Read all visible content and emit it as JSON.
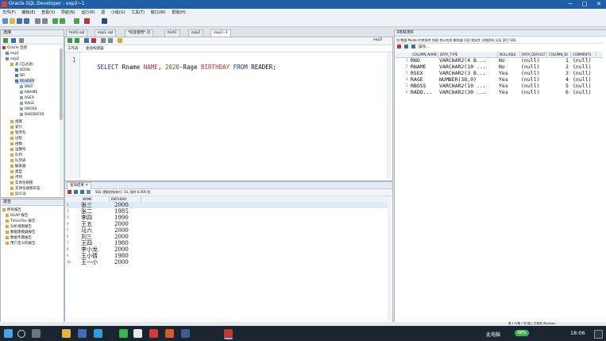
{
  "window": {
    "title": "Oracle SQL Developer : exp2~1",
    "minimize": "─",
    "maximize": "□",
    "close": "✕"
  },
  "menu": [
    "文件(F)",
    "编辑(E)",
    "查看(V)",
    "导航(N)",
    "运行(R)",
    "源",
    "小组(G)",
    "工具(T)",
    "窗口(W)",
    "帮助(H)"
  ],
  "connections": {
    "header": "连接",
    "rows": [
      "Oracle 连接",
      "exp1",
      "exp2",
      "表 (已过滤)",
      "BOOK",
      "BR",
      "READER",
      "RNO",
      "RNAME",
      "RSEX",
      "RAGE",
      "RBOSS",
      "RADDRESS",
      "视图",
      "索引",
      "程序包",
      "过程",
      "函数",
      "运算符",
      "队列",
      "队列表",
      "触发器",
      "类型",
      "序列",
      "实体化视图",
      "实体化视图日志",
      "同义词"
    ]
  },
  "reports": {
    "header": "报告",
    "rows": [
      "所有报告",
      "OLAP 报告",
      "TimesTen 报告",
      "分析视图报告",
      "数据建模器报告",
      "数据字典报告",
      "用户定义的报告"
    ]
  },
  "editor_tabs": [
    "test1.sql",
    "exp1.sql",
    "*欢迎使用*.页",
    "test1",
    "exp2",
    "exp2~1"
  ],
  "editor": {
    "subtabs": [
      "工作表",
      "查询构建器"
    ],
    "conn_label": "exp2",
    "line_no": "1",
    "sql": {
      "kw1": "SELECT",
      "body1": " Rname ",
      "alias1": "NAME",
      "sep": ", ",
      "num": "2020",
      "body2": "-Rage ",
      "alias2": "BIRTHDAY",
      "kw2": " FROM",
      "body3": " READER;"
    }
  },
  "results": {
    "tab": "查询结果",
    "status": "SQL  提取的所有行: 10,  用时 0.005 秒",
    "columns": [
      "NAME",
      "BIRTHDAY"
    ],
    "rows": [
      {
        "n": "1",
        "name": "张三",
        "birthday": "2000"
      },
      {
        "n": "2",
        "name": "张二",
        "birthday": "1985"
      },
      {
        "n": "3",
        "name": "李四",
        "birthday": "1990"
      },
      {
        "n": "4",
        "name": "王五",
        "birthday": "2000"
      },
      {
        "n": "5",
        "name": "马六",
        "birthday": "2000"
      },
      {
        "n": "6",
        "name": "刘三",
        "birthday": "2000"
      },
      {
        "n": "7",
        "name": "王四",
        "birthday": "1980"
      },
      {
        "n": "8",
        "name": "李小龙",
        "birthday": "2000"
      },
      {
        "n": "9",
        "name": "王小倩",
        "birthday": "1980"
      },
      {
        "n": "10",
        "name": "王一小",
        "birthday": "2000"
      }
    ]
  },
  "reader": {
    "header": "READER",
    "subtabs": "列 数据 Model 约束条件 授权 统计信息 触发器 闪回 相关性 详细资料 分区 索引 SQL",
    "action": "操作...",
    "columns": [
      "COLUMN_NAME",
      "DATA_TYPE",
      "NULLABLE",
      "DATA_DEFAULT",
      "COLUMN_ID",
      "COMMENTS"
    ],
    "rows": [
      {
        "n": "1",
        "name": "RNO",
        "type": "VARCHAR2(4 B...",
        "nullable": "No",
        "def": "(null)",
        "id": "1",
        "cm": "(null)"
      },
      {
        "n": "2",
        "name": "RNAME",
        "type": "VARCHAR2(10 ...",
        "nullable": "No",
        "def": "(null)",
        "id": "2",
        "cm": "(null)"
      },
      {
        "n": "3",
        "name": "RSEX",
        "type": "VARCHAR2(3 B...",
        "nullable": "Yes",
        "def": "(null)",
        "id": "3",
        "cm": "(null)"
      },
      {
        "n": "4",
        "name": "RAGE",
        "type": "NUMBER(38,0)",
        "nullable": "Yes",
        "def": "(null)",
        "id": "4",
        "cm": "(null)"
      },
      {
        "n": "5",
        "name": "RBOSS",
        "type": "VARCHAR2(10 ...",
        "nullable": "Yes",
        "def": "(null)",
        "id": "5",
        "cm": "(null)"
      },
      {
        "n": "6",
        "name": "RADD...",
        "type": "VARCHAR2(30 ...",
        "nullable": "Yes",
        "def": "(null)",
        "id": "6",
        "cm": "(null)"
      }
    ]
  },
  "statusbar": {
    "right": "第 1 行第 1 列  插入  已修改  Windows"
  },
  "taskbar": {
    "time": "18:06",
    "battery": "98%",
    "pc": "此电脑"
  }
}
